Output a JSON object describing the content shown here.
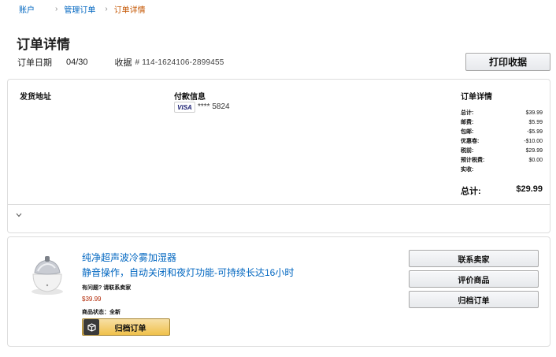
{
  "breadcrumb": {
    "items": [
      "账户",
      "管理订单",
      "订单详情"
    ],
    "separator": "›"
  },
  "page": {
    "title": "订单详情",
    "order_date_label": "订单日期",
    "order_date_value": "04/30",
    "receipt_label": "收据",
    "receipt_number": "# 114-1624106-2899455",
    "print_button": "打印收据"
  },
  "summary": {
    "shipping_title": "发货地址",
    "payment_title": "付款信息",
    "card_brand": "VISA",
    "card_masked": "**** 5824",
    "details_title": "订单详情",
    "costs": [
      {
        "label": "总计:",
        "value": "$39.99"
      },
      {
        "label": "邮费:",
        "value": "$5.99"
      },
      {
        "label": "包邮:",
        "value": "-$5.99"
      },
      {
        "label": "优惠卷:",
        "value": "-$10.00"
      },
      {
        "label": "税前:",
        "value": "$29.99"
      },
      {
        "label": "预计税费:",
        "value": "$0.00"
      },
      {
        "label": "实收:",
        "value": ""
      }
    ],
    "grand_total_label": "总计:",
    "grand_total_value": "$29.99",
    "expand_icon": "chevron-down-icon"
  },
  "item": {
    "title": "纯净超声波冷雾加湿器",
    "subtitle": "静音操作，自动关闭和夜灯功能-可持续长达16小时",
    "question_text": "有问题? 请联系卖家",
    "price": "$39.99",
    "condition_text": "商品状态：全新",
    "archive_button": "归档订单",
    "archive_icon": "box-icon"
  },
  "actions": {
    "contact_seller": "联系卖家",
    "review_product": "评价商品",
    "archive_order": "归档订单"
  },
  "colors": {
    "link": "#0066c0",
    "current_crumb": "#c45500",
    "price": "#b12704",
    "primary_button": "#f0c14b"
  }
}
